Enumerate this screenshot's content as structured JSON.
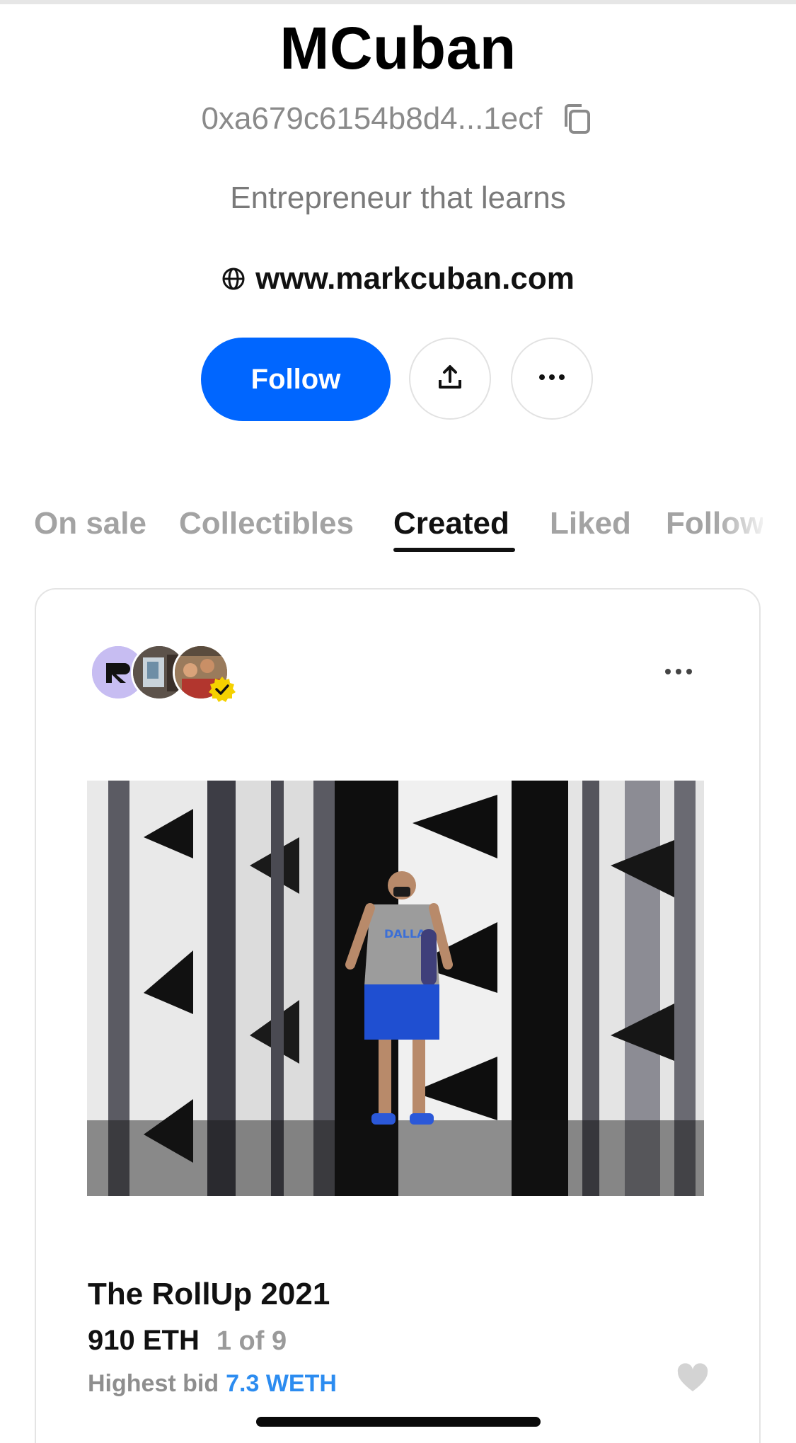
{
  "profile": {
    "name": "MCuban",
    "address": "0xa679c6154b8d4...1ecf",
    "bio": "Entrepreneur that learns",
    "website": "www.markcuban.com"
  },
  "actions": {
    "follow_label": "Follow",
    "share_icon": "share-upload-icon",
    "more_icon": "ellipsis-icon"
  },
  "tabs": [
    {
      "label": "On sale",
      "active": false
    },
    {
      "label": "Collectibles",
      "active": false
    },
    {
      "label": "Created",
      "active": true
    },
    {
      "label": "Liked",
      "active": false
    },
    {
      "label": "Follow",
      "active": false
    }
  ],
  "card": {
    "title": "The RollUp 2021",
    "price": "910 ETH",
    "edition": "1 of 9",
    "bid_label": "Highest bid",
    "bid_value": "7.3 WETH",
    "avatars": [
      "avatar-collection",
      "avatar-owner",
      "avatar-creator-verified"
    ]
  },
  "colors": {
    "accent": "#0066ff",
    "bid": "#2c8cf0",
    "muted": "#8a8a8a",
    "verified": "#f5d100"
  }
}
